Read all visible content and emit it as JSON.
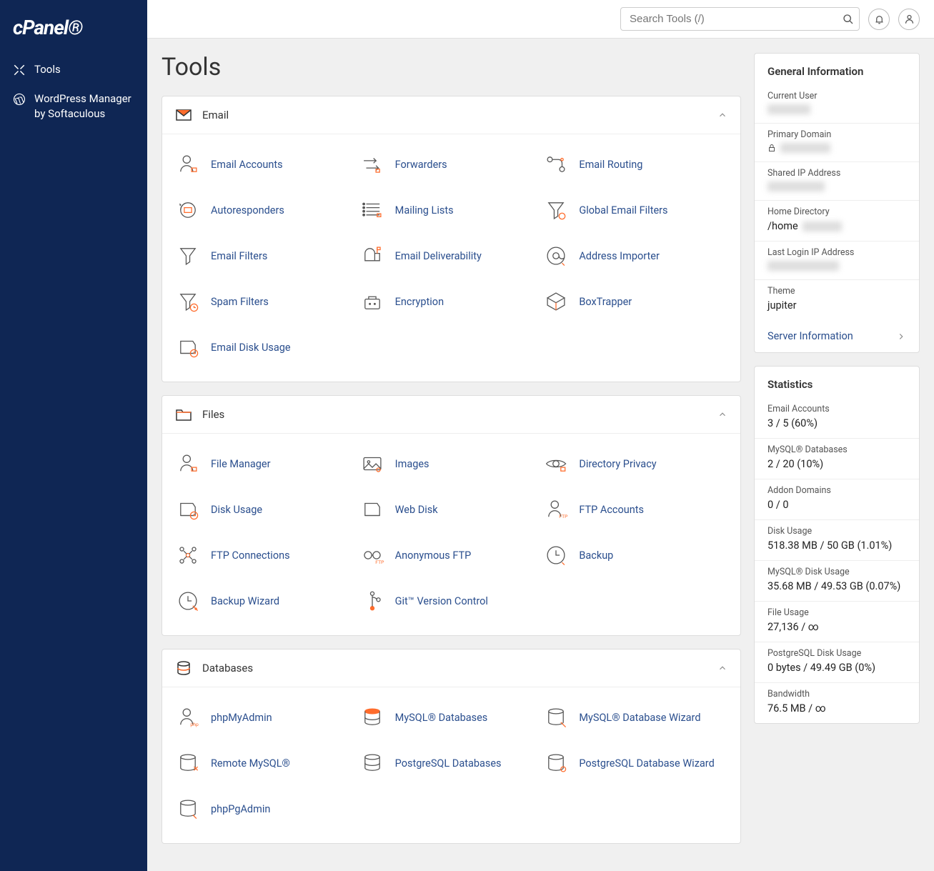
{
  "logo": "cPanel",
  "sidebar": {
    "items": [
      {
        "label": "Tools",
        "icon": "tools"
      },
      {
        "label": "WordPress Manager by Softaculous",
        "icon": "wordpress"
      }
    ]
  },
  "search": {
    "placeholder": "Search Tools (/)"
  },
  "page_title": "Tools",
  "groups": [
    {
      "title": "Email",
      "icon": "mail",
      "items": [
        {
          "label": "Email Accounts",
          "icon": "person"
        },
        {
          "label": "Forwarders",
          "icon": "arrows"
        },
        {
          "label": "Email Routing",
          "icon": "route"
        },
        {
          "label": "Autoresponders",
          "icon": "autoreply"
        },
        {
          "label": "Mailing Lists",
          "icon": "list"
        },
        {
          "label": "Global Email Filters",
          "icon": "funnel-globe"
        },
        {
          "label": "Email Filters",
          "icon": "funnel"
        },
        {
          "label": "Email Deliverability",
          "icon": "mailbox"
        },
        {
          "label": "Address Importer",
          "icon": "at-import"
        },
        {
          "label": "Spam Filters",
          "icon": "funnel-clock"
        },
        {
          "label": "Encryption",
          "icon": "briefcase"
        },
        {
          "label": "BoxTrapper",
          "icon": "box"
        },
        {
          "label": "Email Disk Usage",
          "icon": "disk-clock"
        }
      ]
    },
    {
      "title": "Files",
      "icon": "folder",
      "items": [
        {
          "label": "File Manager",
          "icon": "person"
        },
        {
          "label": "Images",
          "icon": "image"
        },
        {
          "label": "Directory Privacy",
          "icon": "eye"
        },
        {
          "label": "Disk Usage",
          "icon": "disk-clock"
        },
        {
          "label": "Web Disk",
          "icon": "disk"
        },
        {
          "label": "FTP Accounts",
          "icon": "person-ftp"
        },
        {
          "label": "FTP Connections",
          "icon": "network"
        },
        {
          "label": "Anonymous FTP",
          "icon": "glasses"
        },
        {
          "label": "Backup",
          "icon": "clock"
        },
        {
          "label": "Backup Wizard",
          "icon": "clock-wizard"
        },
        {
          "label": "Git™ Version Control",
          "icon": "git"
        }
      ]
    },
    {
      "title": "Databases",
      "icon": "database",
      "items": [
        {
          "label": "phpMyAdmin",
          "icon": "person-php"
        },
        {
          "label": "MySQL® Databases",
          "icon": "db-orange"
        },
        {
          "label": "MySQL® Database Wizard",
          "icon": "db-wizard"
        },
        {
          "label": "Remote MySQL®",
          "icon": "db-remote"
        },
        {
          "label": "PostgreSQL Databases",
          "icon": "db"
        },
        {
          "label": "PostgreSQL Database Wizard",
          "icon": "db-wizard2"
        },
        {
          "label": "phpPgAdmin",
          "icon": "db-pg"
        }
      ]
    }
  ],
  "general_info": {
    "title": "General Information",
    "rows": [
      {
        "label": "Current User",
        "value": "",
        "blurred": true
      },
      {
        "label": "Primary Domain",
        "value": "",
        "blurred": true,
        "lock": true
      },
      {
        "label": "Shared IP Address",
        "value": "",
        "blurred": true
      },
      {
        "label": "Home Directory",
        "value": "/home",
        "partial_blur": true
      },
      {
        "label": "Last Login IP Address",
        "value": "",
        "blurred": true
      },
      {
        "label": "Theme",
        "value": "jupiter"
      }
    ],
    "link": "Server Information"
  },
  "statistics": {
    "title": "Statistics",
    "rows": [
      {
        "label": "Email Accounts",
        "value": "3 / 5   (60%)"
      },
      {
        "label": "MySQL® Databases",
        "value": "2 / 20   (10%)"
      },
      {
        "label": "Addon Domains",
        "value": "0 / 0"
      },
      {
        "label": "Disk Usage",
        "value": "518.38 MB / 50 GB   (1.01%)"
      },
      {
        "label": "MySQL® Disk Usage",
        "value": "35.68 MB / 49.53 GB   (0.07%)"
      },
      {
        "label": "File Usage",
        "value": "27,136 / ∞"
      },
      {
        "label": "PostgreSQL Disk Usage",
        "value": "0 bytes / 49.49 GB   (0%)"
      },
      {
        "label": "Bandwidth",
        "value": "76.5 MB / ∞"
      }
    ]
  }
}
